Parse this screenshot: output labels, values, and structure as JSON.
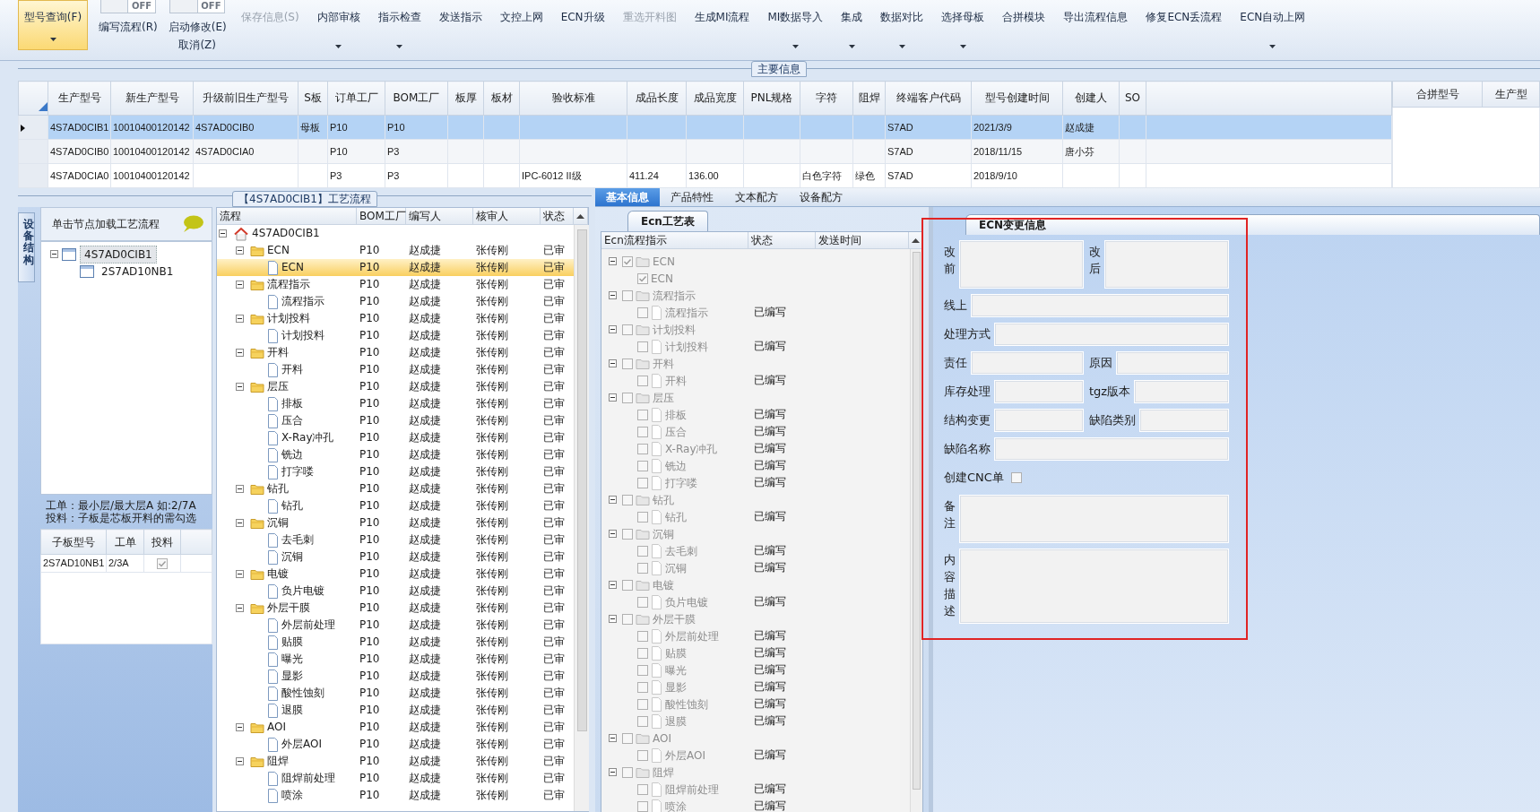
{
  "toolbar": {
    "items": [
      {
        "kind": "button",
        "label": "型号查询(F)",
        "selected": true,
        "disabled": false,
        "dropdown": true
      },
      {
        "kind": "toggle",
        "label": "编写流程(R)",
        "switch_text": "OFF",
        "on": false
      },
      {
        "kind": "toggle",
        "label": "启动修改(E)",
        "sublabel": "取消(Z)",
        "switch_text": "OFF",
        "on": false
      },
      {
        "kind": "button",
        "label": "保存信息(S)",
        "selected": false,
        "disabled": true,
        "dropdown": false
      },
      {
        "kind": "button",
        "label": "内部审核",
        "selected": false,
        "disabled": false,
        "dropdown": true
      },
      {
        "kind": "button",
        "label": "指示检查",
        "selected": false,
        "disabled": false,
        "dropdown": true
      },
      {
        "kind": "button",
        "label": "发送指示",
        "selected": false,
        "disabled": false,
        "dropdown": false
      },
      {
        "kind": "button",
        "label": "文控上网",
        "selected": false,
        "disabled": false,
        "dropdown": false
      },
      {
        "kind": "button",
        "label": "ECN升级",
        "selected": false,
        "disabled": false,
        "dropdown": false
      },
      {
        "kind": "button",
        "label": "重选开料图",
        "selected": false,
        "disabled": true,
        "dropdown": false
      },
      {
        "kind": "button",
        "label": "生成MI流程",
        "selected": false,
        "disabled": false,
        "dropdown": false
      },
      {
        "kind": "button",
        "label": "MI数据导入",
        "selected": false,
        "disabled": false,
        "dropdown": true
      },
      {
        "kind": "button",
        "label": "集成",
        "selected": false,
        "disabled": false,
        "dropdown": true
      },
      {
        "kind": "button",
        "label": "数据对比",
        "selected": false,
        "disabled": false,
        "dropdown": true
      },
      {
        "kind": "button",
        "label": "选择母板",
        "selected": false,
        "disabled": false,
        "dropdown": true
      },
      {
        "kind": "button",
        "label": "合拼模块",
        "selected": false,
        "disabled": false,
        "dropdown": false
      },
      {
        "kind": "button",
        "label": "导出流程信息",
        "selected": false,
        "disabled": false,
        "dropdown": false
      },
      {
        "kind": "button",
        "label": "修复ECN丢流程",
        "selected": false,
        "disabled": false,
        "dropdown": false
      },
      {
        "kind": "button",
        "label": "ECN自动上网",
        "selected": false,
        "disabled": false,
        "dropdown": true
      }
    ]
  },
  "main_info": {
    "title": "主要信息",
    "table": {
      "columns": [
        "生产型号",
        "新生产型号",
        "升级前旧生产型号",
        "S板",
        "订单工厂",
        "BOM工厂",
        "板厚",
        "板材",
        "验收标准",
        "成品长度",
        "成品宽度",
        "PNL规格",
        "字符",
        "阻焊",
        "终端客户代码",
        "型号创建时间",
        "创建人",
        "SO"
      ],
      "rows": [
        {
          "selected": true,
          "cells": [
            "4S7AD0CIB1",
            "10010400120142",
            "4S7AD0CIB0",
            "母板",
            "P10",
            "P10",
            null,
            null,
            null,
            null,
            null,
            null,
            null,
            null,
            "S7AD",
            "2021/3/9",
            "赵成捷",
            null
          ]
        },
        {
          "selected": false,
          "cells": [
            "4S7AD0CIB0",
            "10010400120142",
            "4S7AD0CIA0",
            null,
            "P10",
            "P3",
            null,
            null,
            null,
            null,
            null,
            null,
            null,
            null,
            "S7AD",
            "2018/11/15",
            "唐小芬",
            null
          ]
        },
        {
          "selected": false,
          "cells": [
            "4S7AD0CIA0",
            "10010400120142",
            null,
            null,
            "P3",
            "P3",
            null,
            null,
            "IPC-6012 II级",
            "411.24",
            "136.00",
            null,
            "白色字符",
            "绿色",
            "S7AD",
            "2018/9/10",
            null,
            null
          ]
        }
      ]
    },
    "merge_table": {
      "columns": [
        "合拼型号",
        "生产型"
      ]
    }
  },
  "process_group": {
    "title": "【4S7AD0CIB1】工艺流程"
  },
  "device_panel": {
    "side_tab": "设备结构",
    "hint": "单击节点加载工艺流程",
    "tree": [
      {
        "label": "4S7AD0CIB1",
        "selected": true,
        "expanded": true,
        "children": [
          {
            "label": "2S7AD10NB1",
            "selected": false
          }
        ]
      }
    ],
    "notes": [
      "工单：最小层/最大层A 如:2/7A",
      "投料：子板是芯板开料的需勾选"
    ],
    "sub_table": {
      "columns": [
        "子板型号",
        "工单",
        "投料"
      ],
      "rows": [
        {
          "cells": [
            "2S7AD10NB1",
            "2/3A"
          ],
          "checked": true
        }
      ]
    }
  },
  "process_flow": {
    "columns": [
      "流程",
      "BOM工厂",
      "编写人",
      "核审人",
      "状态"
    ],
    "tree": [
      {
        "kind": "root",
        "label": "4S7AD0CIB1",
        "selected": false,
        "expanded": true,
        "children": [
          {
            "kind": "folder",
            "label": "ECN",
            "bom": "P10",
            "writer": "赵成捷",
            "reviewer": "张传刚",
            "status": "已审",
            "selected": false,
            "expanded": true,
            "children": [
              {
                "kind": "step",
                "label": "ECN",
                "bom": "P10",
                "writer": "赵成捷",
                "reviewer": "张传刚",
                "status": "已审",
                "selected": true
              }
            ]
          },
          {
            "kind": "folder",
            "label": "流程指示",
            "bom": "P10",
            "writer": "赵成捷",
            "reviewer": "张传刚",
            "status": "已审",
            "selected": false,
            "expanded": true,
            "children": [
              {
                "kind": "step",
                "label": "流程指示",
                "bom": "P10",
                "writer": "赵成捷",
                "reviewer": "张传刚",
                "status": "已审",
                "selected": false
              }
            ]
          },
          {
            "kind": "folder",
            "label": "计划投料",
            "bom": "P10",
            "writer": "赵成捷",
            "reviewer": "张传刚",
            "status": "已审",
            "selected": false,
            "expanded": true,
            "children": [
              {
                "kind": "step",
                "label": "计划投料",
                "bom": "P10",
                "writer": "赵成捷",
                "reviewer": "张传刚",
                "status": "已审",
                "selected": false
              }
            ]
          },
          {
            "kind": "folder",
            "label": "开料",
            "bom": "P10",
            "writer": "赵成捷",
            "reviewer": "张传刚",
            "status": "已审",
            "selected": false,
            "expanded": true,
            "children": [
              {
                "kind": "step",
                "label": "开料",
                "bom": "P10",
                "writer": "赵成捷",
                "reviewer": "张传刚",
                "status": "已审",
                "selected": false
              }
            ]
          },
          {
            "kind": "folder",
            "label": "层压",
            "bom": "P10",
            "writer": "赵成捷",
            "reviewer": "张传刚",
            "status": "已审",
            "selected": false,
            "expanded": true,
            "children": [
              {
                "kind": "step",
                "label": "排板",
                "bom": "P10",
                "writer": "赵成捷",
                "reviewer": "张传刚",
                "status": "已审",
                "selected": false
              },
              {
                "kind": "step",
                "label": "压合",
                "bom": "P10",
                "writer": "赵成捷",
                "reviewer": "张传刚",
                "status": "已审",
                "selected": false
              },
              {
                "kind": "step",
                "label": "X-Ray冲孔",
                "bom": "P10",
                "writer": "赵成捷",
                "reviewer": "张传刚",
                "status": "已审",
                "selected": false
              },
              {
                "kind": "step",
                "label": "铣边",
                "bom": "P10",
                "writer": "赵成捷",
                "reviewer": "张传刚",
                "status": "已审",
                "selected": false
              },
              {
                "kind": "step",
                "label": "打字喽",
                "bom": "P10",
                "writer": "赵成捷",
                "reviewer": "张传刚",
                "status": "已审",
                "selected": false
              }
            ]
          },
          {
            "kind": "folder",
            "label": "钻孔",
            "bom": "P10",
            "writer": "赵成捷",
            "reviewer": "张传刚",
            "status": "已审",
            "selected": false,
            "expanded": true,
            "children": [
              {
                "kind": "step",
                "label": "钻孔",
                "bom": "P10",
                "writer": "赵成捷",
                "reviewer": "张传刚",
                "status": "已审",
                "selected": false
              }
            ]
          },
          {
            "kind": "folder",
            "label": "沉铜",
            "bom": "P10",
            "writer": "赵成捷",
            "reviewer": "张传刚",
            "status": "已审",
            "selected": false,
            "expanded": true,
            "children": [
              {
                "kind": "step",
                "label": "去毛刺",
                "bom": "P10",
                "writer": "赵成捷",
                "reviewer": "张传刚",
                "status": "已审",
                "selected": false
              },
              {
                "kind": "step",
                "label": "沉铜",
                "bom": "P10",
                "writer": "赵成捷",
                "reviewer": "张传刚",
                "status": "已审",
                "selected": false
              }
            ]
          },
          {
            "kind": "folder",
            "label": "电镀",
            "bom": "P10",
            "writer": "赵成捷",
            "reviewer": "张传刚",
            "status": "已审",
            "selected": false,
            "expanded": true,
            "children": [
              {
                "kind": "step",
                "label": "负片电镀",
                "bom": "P10",
                "writer": "赵成捷",
                "reviewer": "张传刚",
                "status": "已审",
                "selected": false
              }
            ]
          },
          {
            "kind": "folder",
            "label": "外层干膜",
            "bom": "P10",
            "writer": "赵成捷",
            "reviewer": "张传刚",
            "status": "已审",
            "selected": false,
            "expanded": true,
            "children": [
              {
                "kind": "step",
                "label": "外层前处理",
                "bom": "P10",
                "writer": "赵成捷",
                "reviewer": "张传刚",
                "status": "已审",
                "selected": false
              },
              {
                "kind": "step",
                "label": "贴膜",
                "bom": "P10",
                "writer": "赵成捷",
                "reviewer": "张传刚",
                "status": "已审",
                "selected": false
              },
              {
                "kind": "step",
                "label": "曝光",
                "bom": "P10",
                "writer": "赵成捷",
                "reviewer": "张传刚",
                "status": "已审",
                "selected": false
              },
              {
                "kind": "step",
                "label": "显影",
                "bom": "P10",
                "writer": "赵成捷",
                "reviewer": "张传刚",
                "status": "已审",
                "selected": false
              },
              {
                "kind": "step",
                "label": "酸性蚀刻",
                "bom": "P10",
                "writer": "赵成捷",
                "reviewer": "张传刚",
                "status": "已审",
                "selected": false
              },
              {
                "kind": "step",
                "label": "退膜",
                "bom": "P10",
                "writer": "赵成捷",
                "reviewer": "张传刚",
                "status": "已审",
                "selected": false
              }
            ]
          },
          {
            "kind": "folder",
            "label": "AOI",
            "bom": "P10",
            "writer": "赵成捷",
            "reviewer": "张传刚",
            "status": "已审",
            "selected": false,
            "expanded": true,
            "children": [
              {
                "kind": "step",
                "label": "外层AOI",
                "bom": "P10",
                "writer": "赵成捷",
                "reviewer": "张传刚",
                "status": "已审",
                "selected": false
              }
            ]
          },
          {
            "kind": "folder",
            "label": "阻焊",
            "bom": "P10",
            "writer": "赵成捷",
            "reviewer": "张传刚",
            "status": "已审",
            "selected": false,
            "expanded": true,
            "children": [
              {
                "kind": "step",
                "label": "阻焊前处理",
                "bom": "P10",
                "writer": "赵成捷",
                "reviewer": "张传刚",
                "status": "已审",
                "selected": false
              },
              {
                "kind": "step",
                "label": "喷涂",
                "bom": "P10",
                "writer": "赵成捷",
                "reviewer": "张传刚",
                "status": "已审",
                "selected": false
              }
            ]
          }
        ]
      }
    ]
  },
  "tabs": [
    {
      "label": "基本信息",
      "selected": true
    },
    {
      "label": "产品特性",
      "selected": false
    },
    {
      "label": "文本配方",
      "selected": false
    },
    {
      "label": "设备配方",
      "selected": false
    }
  ],
  "ecn_table": {
    "tab": "Ecn工艺表",
    "columns": [
      "Ecn流程指示",
      "状态",
      "发送时间"
    ],
    "tree": [
      {
        "kind": "folder",
        "label": "ECN",
        "checked": true,
        "expanded": true,
        "children": [
          {
            "kind": "item",
            "label": "ECN",
            "checked": true
          }
        ]
      },
      {
        "kind": "folder",
        "label": "流程指示",
        "checked": false,
        "expanded": true,
        "children": [
          {
            "kind": "step",
            "label": "流程指示",
            "checked": false,
            "status": "已编写"
          }
        ]
      },
      {
        "kind": "folder",
        "label": "计划投料",
        "checked": false,
        "expanded": true,
        "children": [
          {
            "kind": "step",
            "label": "计划投料",
            "checked": false,
            "status": "已编写"
          }
        ]
      },
      {
        "kind": "folder",
        "label": "开料",
        "checked": false,
        "expanded": true,
        "children": [
          {
            "kind": "step",
            "label": "开料",
            "checked": false,
            "status": "已编写"
          }
        ]
      },
      {
        "kind": "folder",
        "label": "层压",
        "checked": false,
        "expanded": true,
        "children": [
          {
            "kind": "step",
            "label": "排板",
            "checked": false,
            "status": "已编写"
          },
          {
            "kind": "step",
            "label": "压合",
            "checked": false,
            "status": "已编写"
          },
          {
            "kind": "step",
            "label": "X-Ray冲孔",
            "checked": false,
            "status": "已编写"
          },
          {
            "kind": "step",
            "label": "铣边",
            "checked": false,
            "status": "已编写"
          },
          {
            "kind": "step",
            "label": "打字喽",
            "checked": false,
            "status": "已编写"
          }
        ]
      },
      {
        "kind": "folder",
        "label": "钻孔",
        "checked": false,
        "expanded": true,
        "children": [
          {
            "kind": "step",
            "label": "钻孔",
            "checked": false,
            "status": "已编写"
          }
        ]
      },
      {
        "kind": "folder",
        "label": "沉铜",
        "checked": false,
        "expanded": true,
        "children": [
          {
            "kind": "step",
            "label": "去毛刺",
            "checked": false,
            "status": "已编写"
          },
          {
            "kind": "step",
            "label": "沉铜",
            "checked": false,
            "status": "已编写"
          }
        ]
      },
      {
        "kind": "folder",
        "label": "电镀",
        "checked": false,
        "expanded": true,
        "children": [
          {
            "kind": "step",
            "label": "负片电镀",
            "checked": false,
            "status": "已编写"
          }
        ]
      },
      {
        "kind": "folder",
        "label": "外层干膜",
        "checked": false,
        "expanded": true,
        "children": [
          {
            "kind": "step",
            "label": "外层前处理",
            "checked": false,
            "status": "已编写"
          },
          {
            "kind": "step",
            "label": "贴膜",
            "checked": false,
            "status": "已编写"
          },
          {
            "kind": "step",
            "label": "曝光",
            "checked": false,
            "status": "已编写"
          },
          {
            "kind": "step",
            "label": "显影",
            "checked": false,
            "status": "已编写"
          },
          {
            "kind": "step",
            "label": "酸性蚀刻",
            "checked": false,
            "status": "已编写"
          },
          {
            "kind": "step",
            "label": "退膜",
            "checked": false,
            "status": "已编写"
          }
        ]
      },
      {
        "kind": "folder",
        "label": "AOI",
        "checked": false,
        "expanded": true,
        "children": [
          {
            "kind": "step",
            "label": "外层AOI",
            "checked": false,
            "status": "已编写"
          }
        ]
      },
      {
        "kind": "folder",
        "label": "阻焊",
        "checked": false,
        "expanded": true,
        "children": [
          {
            "kind": "step",
            "label": "阻焊前处理",
            "checked": false,
            "status": "已编写"
          },
          {
            "kind": "step",
            "label": "喷涂",
            "checked": false,
            "status": "已编写"
          }
        ]
      }
    ]
  },
  "ecn_change": {
    "tab": "ECN变更信息",
    "highlighted": true,
    "rows": [
      {
        "fields": [
          {
            "label": "改前",
            "kind": "textarea"
          },
          {
            "label": "改后",
            "kind": "textarea"
          }
        ]
      },
      {
        "fields": [
          {
            "label": "线上",
            "kind": "input"
          }
        ]
      },
      {
        "fields": [
          {
            "label": "处理方式",
            "kind": "input"
          }
        ]
      },
      {
        "fields": [
          {
            "label": "责任",
            "kind": "input"
          },
          {
            "label": "原因",
            "kind": "input"
          }
        ]
      },
      {
        "fields": [
          {
            "label": "库存处理",
            "kind": "input"
          },
          {
            "label": "tgz版本",
            "kind": "input"
          }
        ]
      },
      {
        "fields": [
          {
            "label": "结构变更",
            "kind": "input"
          },
          {
            "label": "缺陷类别",
            "kind": "input"
          }
        ]
      },
      {
        "fields": [
          {
            "label": "缺陷名称",
            "kind": "input"
          }
        ]
      },
      {
        "fields": [
          {
            "label": "创建CNC单",
            "kind": "checkbox",
            "checked": false
          }
        ]
      },
      {
        "fields": [
          {
            "label": "备注",
            "kind": "textarea"
          }
        ]
      },
      {
        "fields": [
          {
            "label": "内容描述",
            "kind": "textarea"
          }
        ]
      }
    ]
  }
}
